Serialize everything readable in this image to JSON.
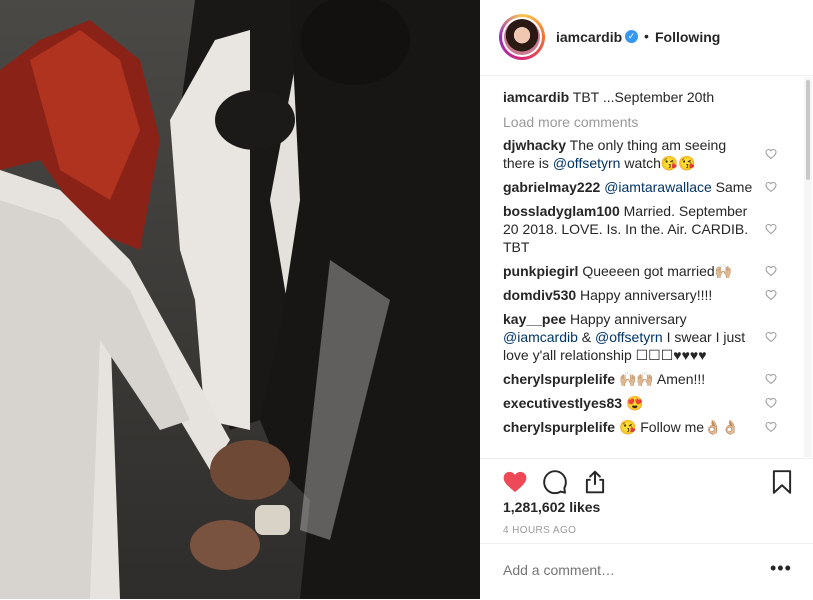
{
  "header": {
    "username": "iamcardib",
    "dot": "•",
    "follow_label": "Following",
    "verified_glyph": "✓"
  },
  "caption": {
    "username": "iamcardib",
    "text": "TBT ...September 20th"
  },
  "load_more": "Load more comments",
  "comments": [
    {
      "user": "djwhacky",
      "parts": [
        {
          "t": "The only thing am seeing there is "
        },
        {
          "t": "@offsetyrn",
          "m": true
        },
        {
          "t": " watch😘😘"
        }
      ]
    },
    {
      "user": "gabrielmay222",
      "parts": [
        {
          "t": "@iamtarawallace",
          "m": true
        },
        {
          "t": " Same"
        }
      ]
    },
    {
      "user": "bossladyglam100",
      "parts": [
        {
          "t": "Married. September 20 2018. LOVE. Is. In the. Air. CARDIB. TBT"
        }
      ]
    },
    {
      "user": "punkpiegirl",
      "parts": [
        {
          "t": "Queeeen got married🙌🏼"
        }
      ]
    },
    {
      "user": "domdiv530",
      "parts": [
        {
          "t": "Happy anniversary!!!!"
        }
      ]
    },
    {
      "user": "kay__pee",
      "parts": [
        {
          "t": "Happy anniversary "
        },
        {
          "t": "@iamcardib",
          "m": true
        },
        {
          "t": " & "
        },
        {
          "t": "@offsetyrn",
          "m": true
        },
        {
          "t": " I swear I just love y'all relationship ☐☐☐♥♥♥♥"
        }
      ]
    },
    {
      "user": "cherylspurplelife",
      "parts": [
        {
          "t": "🙌🏼🙌🏼 Amen!!!"
        }
      ]
    },
    {
      "user": "executivestlyes83",
      "parts": [
        {
          "t": "😍"
        }
      ]
    },
    {
      "user": "cherylspurplelife",
      "parts": [
        {
          "t": "😘 Follow me👌🏼👌🏼"
        }
      ]
    }
  ],
  "likes": {
    "count": "1,281,602",
    "label": "likes"
  },
  "time": "4 HOURS AGO",
  "add_comment": {
    "placeholder": "Add a comment…",
    "more": "•••"
  },
  "colors": {
    "like_red": "#ed4956",
    "text": "#262626",
    "muted": "#999999",
    "mention": "#003569",
    "verified": "#3897f0"
  }
}
